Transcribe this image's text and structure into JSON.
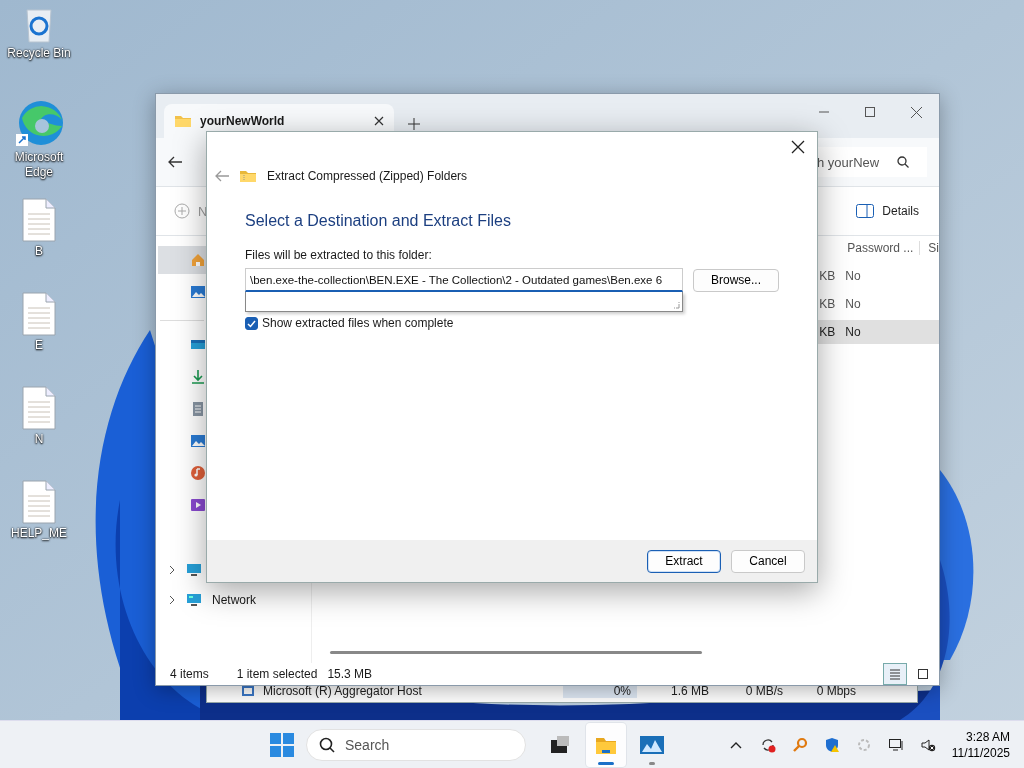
{
  "desktop_icons": [
    {
      "label": "Recycle Bin",
      "kind": "recycle"
    },
    {
      "label": "Microsoft Edge",
      "kind": "edge"
    },
    {
      "label": "B",
      "kind": "file"
    },
    {
      "label": "E",
      "kind": "file"
    },
    {
      "label": "N",
      "kind": "file"
    },
    {
      "label": "HELP_ME",
      "kind": "file"
    }
  ],
  "background_window": {
    "row": [
      "Microsoft (R) Aggregator Host",
      "0%",
      "1.6 MB",
      "0 MB/s",
      "0 Mbps"
    ]
  },
  "explorer": {
    "tab": {
      "title": "yourNewWorld",
      "selected": true
    },
    "search_placeholder": "h yourNew",
    "new_button": "N",
    "details_button": "Details",
    "columns": [
      "Password ...",
      "Si"
    ],
    "rows": [
      {
        "column_1": "KB",
        "password": "No",
        "selected": false
      },
      {
        "column_1": "KB",
        "password": "No",
        "selected": false
      },
      {
        "column_1": "KB",
        "password": "No",
        "selected": true
      }
    ],
    "sidebar": [
      {
        "kind": "home",
        "selected": true
      },
      {
        "kind": "gallery",
        "selected": false
      },
      {
        "kind": "desktop",
        "selected": false
      },
      {
        "kind": "downloads",
        "selected": false
      },
      {
        "kind": "documents",
        "selected": false
      },
      {
        "kind": "pictures",
        "selected": false
      },
      {
        "kind": "music",
        "selected": false
      },
      {
        "kind": "videos",
        "selected": false
      }
    ],
    "tree": [
      {
        "kind": "pc",
        "expanded": false
      },
      {
        "kind": "network",
        "label": "Network",
        "expanded": false
      }
    ],
    "status": {
      "items": "4 items",
      "selection": "1 item selected",
      "size": "15.3 MB"
    },
    "views": [
      {
        "kind": "details",
        "selected": true
      },
      {
        "kind": "tiles",
        "selected": false
      }
    ]
  },
  "dialog": {
    "title": "Extract Compressed (Zipped) Folders",
    "heading": "Select a Destination and Extract Files",
    "field_label": "Files will be extracted to this folder:",
    "path": "\\ben.exe-the-collection\\BEN.EXE - The Collection\\2 - Outdated games\\Ben.exe 6",
    "browse": "Browse...",
    "show_files": {
      "label": "Show extracted files when complete",
      "checked": true
    },
    "buttons": [
      {
        "label": "Extract",
        "kind": "primary"
      },
      {
        "label": "Cancel",
        "kind": "normal"
      }
    ]
  },
  "taskbar": {
    "search_placeholder": "Search",
    "apps": [
      {
        "kind": "taskview",
        "selected": false,
        "running": false
      },
      {
        "kind": "explorer",
        "selected": true,
        "running": true
      },
      {
        "kind": "monitor",
        "selected": false,
        "running": true
      }
    ],
    "tray": [
      {
        "kind": "chevron"
      },
      {
        "kind": "sync"
      },
      {
        "kind": "key"
      },
      {
        "kind": "shield"
      },
      {
        "kind": "spinner"
      },
      {
        "kind": "network"
      },
      {
        "kind": "volume"
      }
    ],
    "time": "3:28 AM",
    "date": "11/11/2025"
  }
}
